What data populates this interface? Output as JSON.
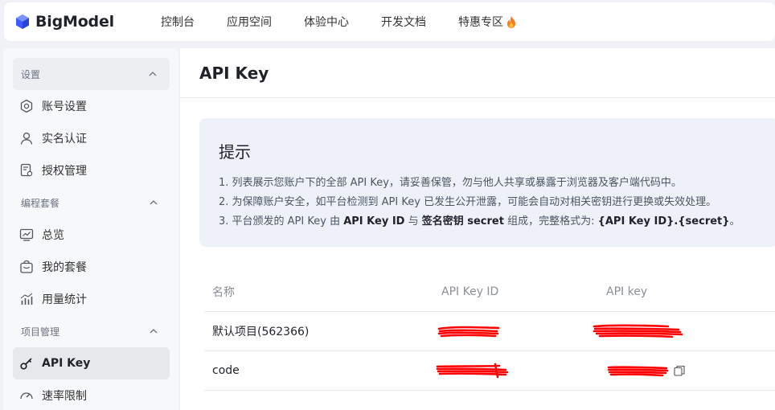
{
  "app": {
    "logo_text": "BigModel"
  },
  "nav": {
    "items": [
      "控制台",
      "应用空间",
      "体验中心",
      "开发文档",
      "特惠专区"
    ]
  },
  "sidebar": {
    "groups": [
      {
        "label": "设置",
        "items": [
          "账号设置",
          "实名认证",
          "授权管理"
        ]
      },
      {
        "label": "编程套餐",
        "items": [
          "总览",
          "我的套餐",
          "用量统计"
        ]
      },
      {
        "label": "项目管理",
        "items": [
          "API Key",
          "速率限制"
        ]
      }
    ],
    "active_item": "API Key"
  },
  "page": {
    "title": "API Key"
  },
  "tip": {
    "title": "提示",
    "line1": "1. 列表展示您账户下的全部 API Key，请妥善保管，勿与他人共享或暴露于浏览器及客户端代码中。",
    "line2": "2. 为保障账户安全，如平台检测到 API Key 已发生公开泄露，可能会自动对相关密钥进行更换或失效处理。",
    "line3_a": "3. 平台颁发的 API Key 由 ",
    "line3_b": "API Key ID",
    "line3_c": " 与 ",
    "line3_d": "签名密钥 secret",
    "line3_e": " 组成，完整格式为: ",
    "line3_f": "{API Key ID}.{secret}",
    "line3_g": "。"
  },
  "table": {
    "columns": [
      "名称",
      "API Key ID",
      "API key"
    ],
    "rows": [
      {
        "name": "默认项目(562366)"
      },
      {
        "name": "code"
      }
    ]
  },
  "colors": {
    "accent": "#4f6ef7",
    "redact": "#ff0000",
    "fire": "#ff7a1a"
  }
}
